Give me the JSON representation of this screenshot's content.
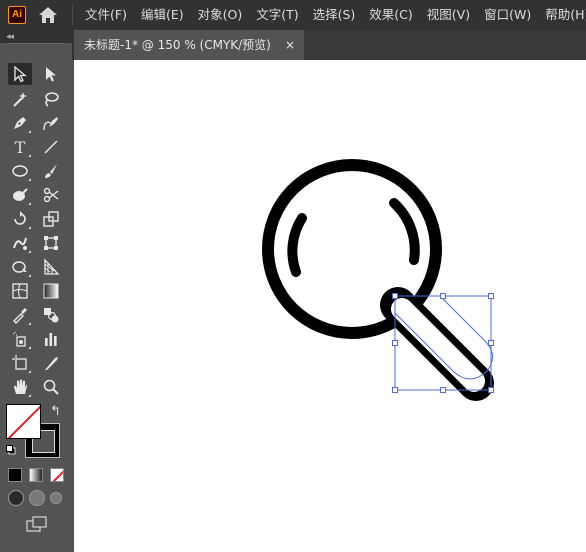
{
  "app": {
    "logo_text": "Ai"
  },
  "menu": {
    "items": [
      "文件(F)",
      "编辑(E)",
      "对象(O)",
      "文字(T)",
      "选择(S)",
      "效果(C)",
      "视图(V)",
      "窗口(W)",
      "帮助(H)"
    ]
  },
  "panel": {
    "collapse_glyph": "◂◂"
  },
  "document": {
    "tab_title": "未标题-1* @ 150 % (CMYK/预览)",
    "close_glyph": "×"
  },
  "colors": {
    "menubar_bg": "#323232",
    "panel_bg": "#535353",
    "canvas_bg": "#ffffff",
    "selection": "#4a6ed6",
    "artwork": "#000000",
    "logo_accent": "#ff9a00"
  },
  "tools": [
    {
      "name": "selection-tool",
      "icon": "arrow-outline",
      "active": true
    },
    {
      "name": "direct-selection-tool",
      "icon": "arrow-solid"
    },
    {
      "name": "magic-wand-tool",
      "icon": "magic-wand"
    },
    {
      "name": "lasso-tool",
      "icon": "lasso"
    },
    {
      "name": "pen-tool",
      "icon": "pen"
    },
    {
      "name": "curvature-tool",
      "icon": "pen-curve"
    },
    {
      "name": "type-tool",
      "icon": "T",
      "glyph": "T"
    },
    {
      "name": "line-segment-tool",
      "icon": "line"
    },
    {
      "name": "ellipse-tool",
      "icon": "ellipse"
    },
    {
      "name": "paintbrush-tool",
      "icon": "brush"
    },
    {
      "name": "shaper-tool",
      "icon": "blob"
    },
    {
      "name": "scissors-tool",
      "icon": "scissors"
    },
    {
      "name": "rotate-tool",
      "icon": "rotate"
    },
    {
      "name": "scale-tool",
      "icon": "scale"
    },
    {
      "name": "puppet-warp-tool",
      "icon": "warp"
    },
    {
      "name": "free-transform-tool",
      "icon": "free-transform"
    },
    {
      "name": "shape-builder-tool",
      "icon": "shape-builder"
    },
    {
      "name": "perspective-grid-tool",
      "icon": "perspective"
    },
    {
      "name": "mesh-tool",
      "icon": "mesh"
    },
    {
      "name": "gradient-tool",
      "icon": "gradient"
    },
    {
      "name": "eyedropper-tool",
      "icon": "eyedropper"
    },
    {
      "name": "blend-tool",
      "icon": "blend"
    },
    {
      "name": "symbol-sprayer-tool",
      "icon": "symbol-sprayer"
    },
    {
      "name": "column-graph-tool",
      "icon": "column-graph"
    },
    {
      "name": "artboard-tool",
      "icon": "artboard"
    },
    {
      "name": "slice-tool",
      "icon": "slice"
    },
    {
      "name": "hand-tool",
      "icon": "hand"
    },
    {
      "name": "zoom-tool",
      "icon": "magnifier"
    }
  ],
  "color_controls": {
    "fill": "none",
    "stroke": "#000000",
    "swap_glyph": "↰"
  }
}
